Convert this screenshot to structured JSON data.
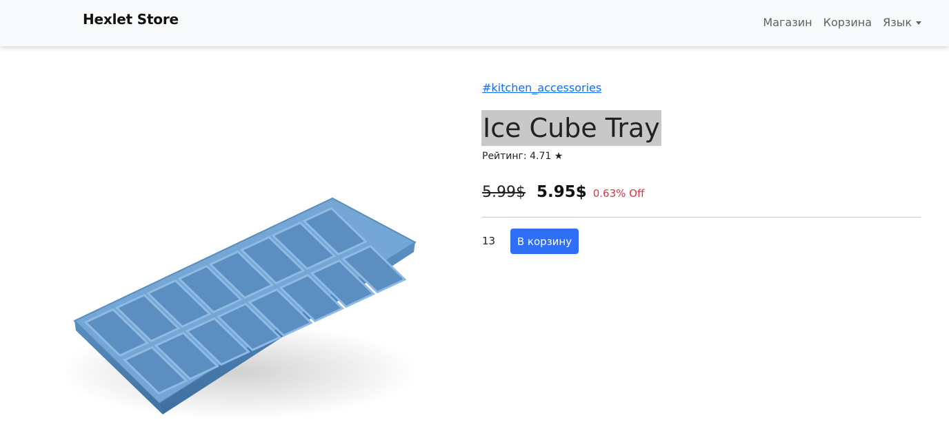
{
  "navbar": {
    "brand": "Hexlet Store",
    "links": [
      "Магазин",
      "Корзина"
    ],
    "language_label": "Язык"
  },
  "product": {
    "tag": "#kitchen_accessories",
    "title": "Ice Cube Tray",
    "rating_text": "Рейтинг: 4.71 ★",
    "old_price": "5.99$",
    "new_price": "5.95$",
    "discount": "0.63% Off",
    "quantity": "13",
    "add_to_cart_label": "В корзину"
  },
  "colors": {
    "accent": "#2f6ff5",
    "discount": "#dc3545",
    "tray": "#6b9fcf"
  }
}
